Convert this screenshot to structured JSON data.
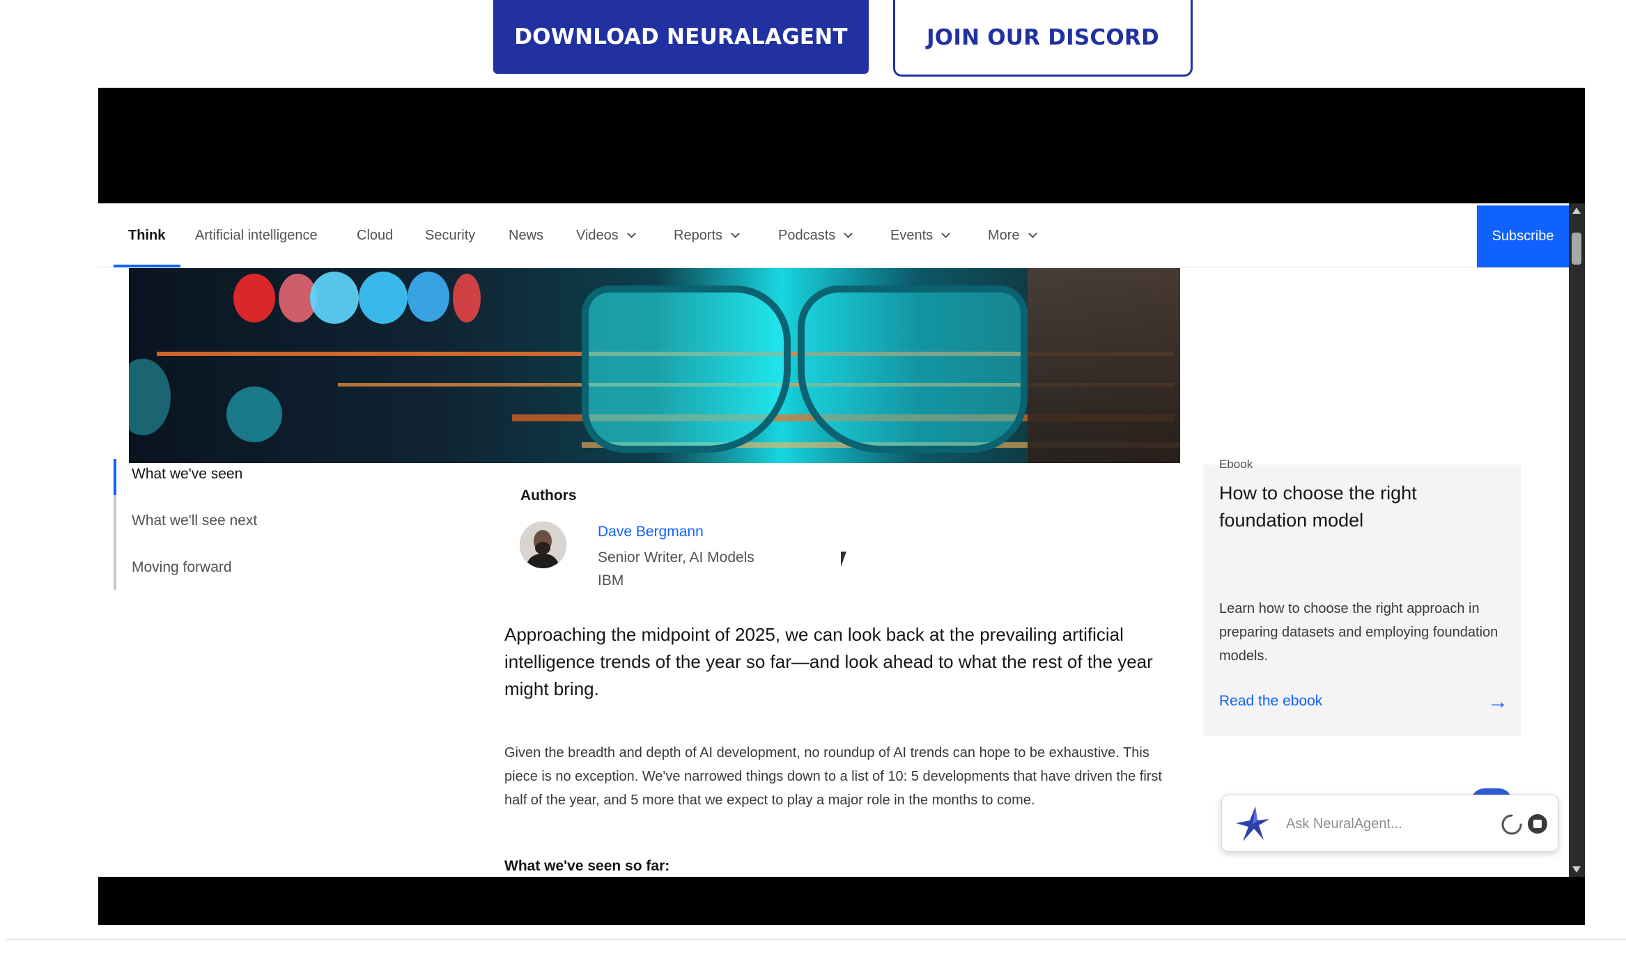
{
  "cta": {
    "download_label": "DOWNLOAD NEURALAGENT",
    "discord_label": "JOIN OUR DISCORD"
  },
  "nav": {
    "active": "Think",
    "items": [
      {
        "label": "Think",
        "dropdown": false
      },
      {
        "label": "Artificial intelligence",
        "dropdown": false
      },
      {
        "label": "Cloud",
        "dropdown": false
      },
      {
        "label": "Security",
        "dropdown": false
      },
      {
        "label": "News",
        "dropdown": false
      },
      {
        "label": "Videos",
        "dropdown": true
      },
      {
        "label": "Reports",
        "dropdown": true
      },
      {
        "label": "Podcasts",
        "dropdown": true
      },
      {
        "label": "Events",
        "dropdown": true
      },
      {
        "label": "More",
        "dropdown": true
      }
    ],
    "subscribe_label": "Subscribe"
  },
  "toc": {
    "items": [
      "What we've seen",
      "What we'll see next",
      "Moving forward"
    ]
  },
  "article": {
    "authors_heading": "Authors",
    "author": {
      "name": "Dave Bergmann",
      "role": "Senior Writer, AI Models",
      "org": "IBM"
    },
    "lede": "Approaching the midpoint of 2025, we can look back at the prevailing artificial intelligence trends of the year so far—and look ahead to what the rest of the year might bring.",
    "body": "Given the breadth and depth of AI development, no roundup of AI trends can hope to be exhaustive. This piece is no exception. We've narrowed things down to a list of 10: 5 developments that have driven the first half of the year, and 5 more that we expect to play a major role in the months to come.",
    "subhead": "What we've seen so far:"
  },
  "side_card": {
    "eyebrow": "Ebook",
    "title": "How to choose the right foundation model",
    "description": "Learn how to choose the right approach in preparing datasets and employing foundation models.",
    "link_label": "Read the ebook"
  },
  "ask_widget": {
    "placeholder": "Ask NeuralAgent..."
  },
  "colors": {
    "cta_blue": "#2231a1",
    "ibm_blue": "#0f62fe",
    "frame_black": "#000000"
  }
}
